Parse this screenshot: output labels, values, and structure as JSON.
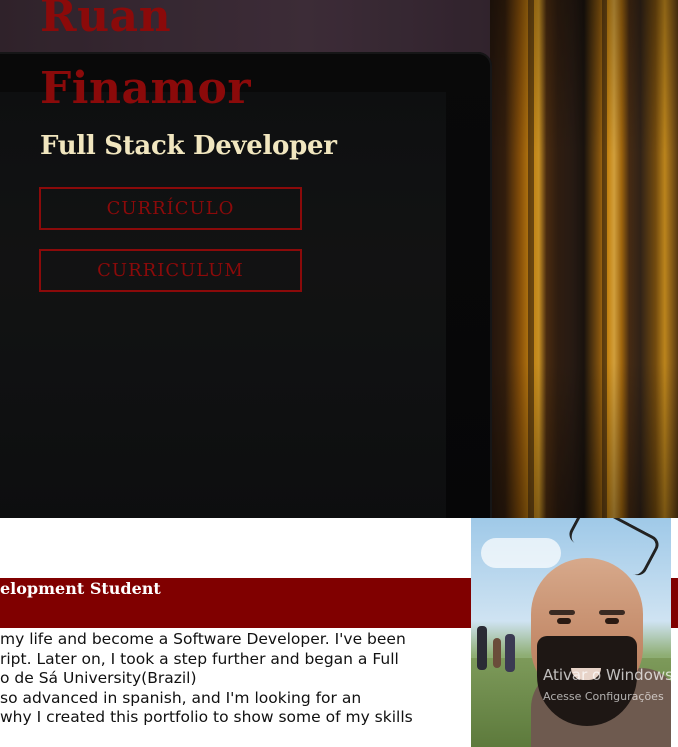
{
  "hero": {
    "first_name": "Ruan",
    "last_name": "Finamor",
    "role": "Full Stack Developer",
    "buttons": [
      {
        "label": "CURRÍCULO"
      },
      {
        "label": "CURRICULUM"
      }
    ]
  },
  "about": {
    "title": "elopment Student",
    "lines": [
      "my life and become a Software Developer. I've been",
      "ript. Later on, I took a step further and began a Full",
      "o de Sá University(Brazil)",
      "so advanced in spanish, and I'm looking for an",
      " why I created this portfolio to show some of my skills"
    ]
  },
  "watermark": {
    "title": "Ativar o Windows",
    "subtitle": "Acesse Configurações"
  },
  "colors": {
    "accent": "#8b0a0a",
    "role_text": "#f1e6bf",
    "about_bar": "#800000"
  }
}
